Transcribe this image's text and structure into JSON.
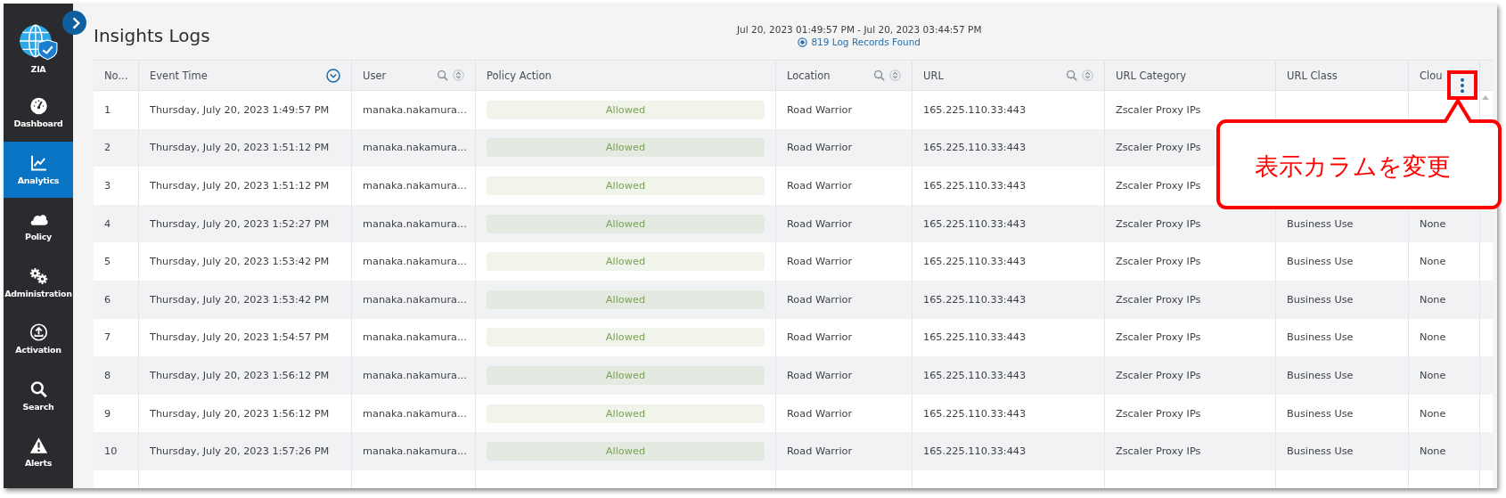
{
  "sidebar": {
    "items": [
      {
        "label": "ZIA",
        "selected": false
      },
      {
        "label": "Dashboard",
        "selected": false
      },
      {
        "label": "Analytics",
        "selected": true
      },
      {
        "label": "Policy",
        "selected": false
      },
      {
        "label": "Administration",
        "selected": false
      },
      {
        "label": "Activation",
        "selected": false
      },
      {
        "label": "Search",
        "selected": false
      },
      {
        "label": "Alerts",
        "selected": false
      }
    ]
  },
  "header": {
    "title": "Insights Logs",
    "time_range": "Jul 20, 2023 01:49:57 PM - Jul 20, 2023 03:44:57 PM",
    "records": "819 Log Records Found"
  },
  "table": {
    "columns": [
      {
        "label": "No...",
        "kind": "text",
        "searchable": false,
        "sortable": false,
        "sorted": false
      },
      {
        "label": "Event Time",
        "kind": "text",
        "searchable": false,
        "sortable": true,
        "sorted": true
      },
      {
        "label": "User",
        "kind": "text",
        "searchable": true,
        "sortable": true,
        "sorted": false
      },
      {
        "label": "Policy Action",
        "kind": "pill",
        "searchable": false,
        "sortable": false,
        "sorted": false
      },
      {
        "label": "Location",
        "kind": "text",
        "searchable": true,
        "sortable": true,
        "sorted": false
      },
      {
        "label": "URL",
        "kind": "text",
        "searchable": true,
        "sortable": true,
        "sorted": false
      },
      {
        "label": "URL Category",
        "kind": "text",
        "searchable": false,
        "sortable": false,
        "sorted": false
      },
      {
        "label": "URL Class",
        "kind": "text",
        "searchable": false,
        "sortable": false,
        "sorted": false
      },
      {
        "label": "Clou",
        "kind": "text"
      }
    ],
    "rows": [
      {
        "cells": [
          "1",
          "Thursday, July 20, 2023 1:49:57 PM",
          "manaka.nakamura...",
          "Allowed",
          "Road Warrior",
          "165.225.110.33:443",
          "Zscaler Proxy IPs"
        ]
      },
      {
        "cells": [
          "2",
          "Thursday, July 20, 2023 1:51:12 PM",
          "manaka.nakamura...",
          "Allowed",
          "Road Warrior",
          "165.225.110.33:443",
          "Zscaler Proxy IPs"
        ]
      },
      {
        "cells": [
          "3",
          "Thursday, July 20, 2023 1:51:12 PM",
          "manaka.nakamura...",
          "Allowed",
          "Road Warrior",
          "165.225.110.33:443",
          "Zscaler Proxy IPs"
        ]
      },
      {
        "cells": [
          "4",
          "Thursday, July 20, 2023 1:52:27 PM",
          "manaka.nakamura...",
          "Allowed",
          "Road Warrior",
          "165.225.110.33:443",
          "Zscaler Proxy IPs",
          "Business Use",
          "None"
        ]
      },
      {
        "cells": [
          "5",
          "Thursday, July 20, 2023 1:53:42 PM",
          "manaka.nakamura...",
          "Allowed",
          "Road Warrior",
          "165.225.110.33:443",
          "Zscaler Proxy IPs",
          "Business Use",
          "None"
        ]
      },
      {
        "cells": [
          "6",
          "Thursday, July 20, 2023 1:53:42 PM",
          "manaka.nakamura...",
          "Allowed",
          "Road Warrior",
          "165.225.110.33:443",
          "Zscaler Proxy IPs",
          "Business Use",
          "None"
        ]
      },
      {
        "cells": [
          "7",
          "Thursday, July 20, 2023 1:54:57 PM",
          "manaka.nakamura...",
          "Allowed",
          "Road Warrior",
          "165.225.110.33:443",
          "Zscaler Proxy IPs",
          "Business Use",
          "None"
        ]
      },
      {
        "cells": [
          "8",
          "Thursday, July 20, 2023 1:56:12 PM",
          "manaka.nakamura...",
          "Allowed",
          "Road Warrior",
          "165.225.110.33:443",
          "Zscaler Proxy IPs",
          "Business Use",
          "None"
        ]
      },
      {
        "cells": [
          "9",
          "Thursday, July 20, 2023 1:56:12 PM",
          "manaka.nakamura...",
          "Allowed",
          "Road Warrior",
          "165.225.110.33:443",
          "Zscaler Proxy IPs",
          "Business Use",
          "None"
        ]
      },
      {
        "cells": [
          "10",
          "Thursday, July 20, 2023 1:57:26 PM",
          "manaka.nakamura...",
          "Allowed",
          "Road Warrior",
          "165.225.110.33:443",
          "Zscaler Proxy IPs",
          "Business Use",
          "None"
        ]
      }
    ]
  },
  "callout": {
    "text": "表示カラムを変更"
  }
}
